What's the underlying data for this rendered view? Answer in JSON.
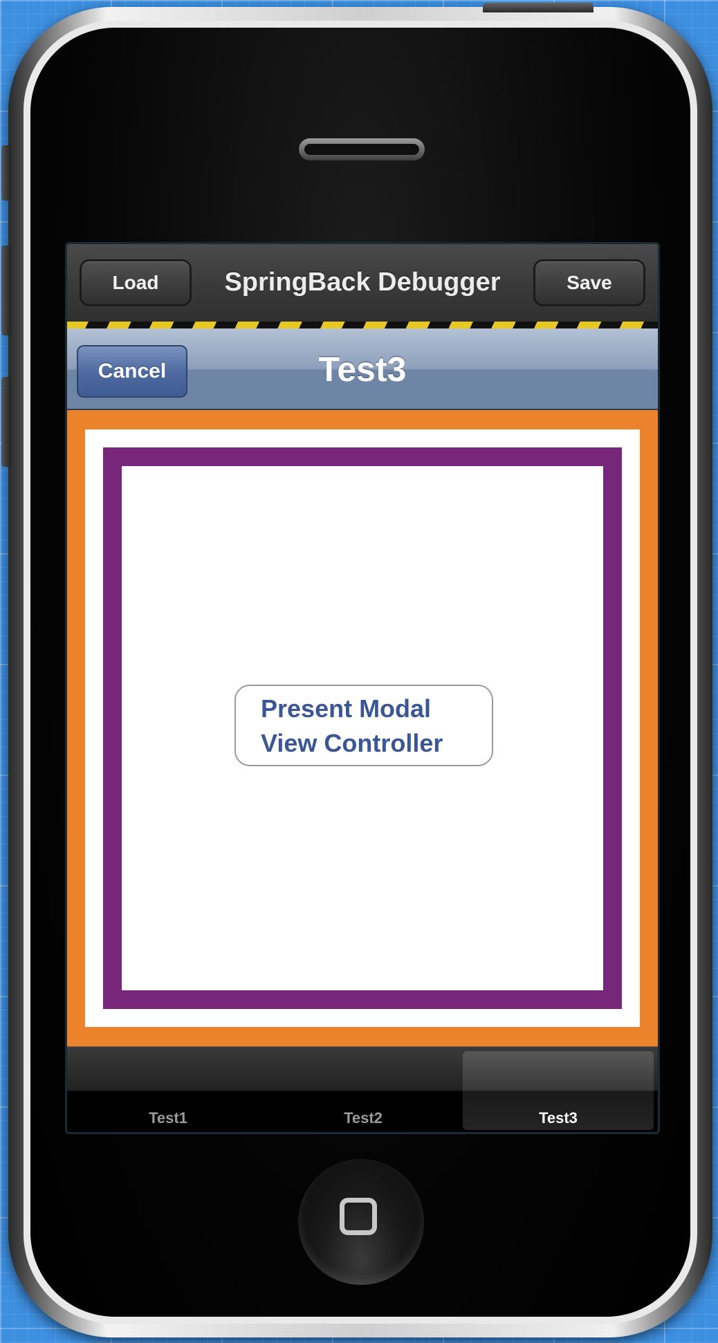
{
  "debugger_toolbar": {
    "load_label": "Load",
    "title": "SpringBack Debugger",
    "save_label": "Save"
  },
  "nav_bar": {
    "cancel_label": "Cancel",
    "title": "Test3"
  },
  "content": {
    "button_line1": "Present Modal",
    "button_line2": "View Controller"
  },
  "tab_bar": {
    "tabs": [
      {
        "label": "Test1",
        "selected": false
      },
      {
        "label": "Test2",
        "selected": false
      },
      {
        "label": "Test3",
        "selected": true
      }
    ]
  },
  "colors": {
    "background": "#3d8fe0",
    "nav_accent": "#4e6aa0",
    "content_orange": "#ea832c",
    "content_purple": "#77267a",
    "button_text": "#3a5694",
    "hazard_yellow": "#e8c822"
  }
}
